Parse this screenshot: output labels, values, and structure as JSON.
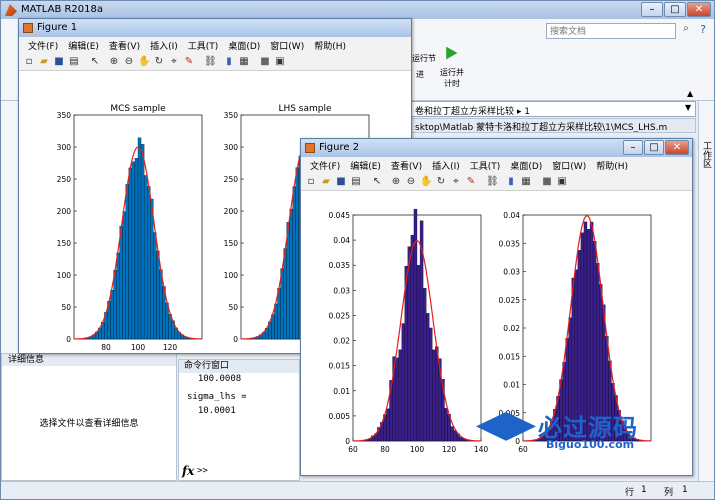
{
  "app": {
    "title": "MATLAB R2018a",
    "search_placeholder": "搜索文档",
    "toolstrip_run_section": "运行节",
    "toolstrip_advance": "进",
    "toolstrip_run_time": "运行并\n计时",
    "address_path": "卷和拉丁超立方采样比较 ▸ 1",
    "editor_tab": "sktop\\Matlab 蒙特卡洛和拉丁超立方采样比较\\1\\MCS_LHS.m",
    "right_panel_label": "工作区"
  },
  "detail_panel": {
    "title": "详细信息",
    "message": "选择文件以查看详细信息"
  },
  "command_window": {
    "title": "命令行窗口",
    "lines": [
      "  100.0008",
      "",
      "",
      "sigma_lhs =",
      "",
      "  10.0001"
    ],
    "prompt": ">>",
    "fx": "fx"
  },
  "status": {
    "line_label": "行",
    "line_value": "1",
    "col_label": "列",
    "col_value": "1"
  },
  "figure1": {
    "title": "Figure 1",
    "menu": [
      "文件(F)",
      "编辑(E)",
      "查看(V)",
      "插入(I)",
      "工具(T)",
      "桌面(D)",
      "窗口(W)",
      "帮助(H)"
    ]
  },
  "figure2": {
    "title": "Figure 2",
    "menu": [
      "文件(F)",
      "编辑(E)",
      "查看(V)",
      "插入(I)",
      "工具(T)",
      "桌面(D)",
      "窗口(W)",
      "帮助(H)"
    ]
  },
  "watermark": {
    "text1": "必过源码",
    "text2": "Biguo100.com"
  },
  "chart_data": [
    {
      "type": "bar",
      "title": "MCS sample",
      "ylim": [
        0,
        350
      ],
      "yticks": [
        0,
        50,
        100,
        150,
        200,
        250,
        300,
        350
      ],
      "xlim": [
        60,
        140
      ],
      "xticks": [
        80,
        100,
        120
      ],
      "mean": 100,
      "sigma": 10,
      "peak": 300,
      "bar_color": "#0072BD",
      "curve_color": "#e0231c"
    },
    {
      "type": "bar",
      "title": "LHS sample",
      "ylim": [
        0,
        350
      ],
      "yticks": [
        0,
        50,
        100,
        150,
        200,
        250,
        300,
        350
      ],
      "xlim": [
        60,
        140
      ],
      "xticks": [],
      "mean": 100,
      "sigma": 10,
      "peak": 300,
      "bar_color": "#0072BD",
      "curve_color": "#e0231c"
    },
    {
      "type": "bar",
      "title": "",
      "ylim": [
        0,
        0.045
      ],
      "yticks": [
        0,
        0.005,
        0.01,
        0.015,
        0.02,
        0.025,
        0.03,
        0.035,
        0.04,
        0.045
      ],
      "xlim": [
        60,
        140
      ],
      "xticks": [
        60,
        80,
        100,
        120,
        140
      ],
      "mean": 100,
      "sigma": 10,
      "peak": 0.0399,
      "bar_color": "#3a1f8c",
      "curve_color": "#e0231c"
    },
    {
      "type": "bar",
      "title": "",
      "ylim": [
        0,
        0.04
      ],
      "yticks": [
        0,
        0.005,
        0.01,
        0.015,
        0.02,
        0.025,
        0.03,
        0.035,
        0.04
      ],
      "xlim": [
        60,
        140
      ],
      "xticks": [
        60
      ],
      "mean": 100,
      "sigma": 10,
      "peak": 0.0399,
      "bar_color": "#3a1f8c",
      "curve_color": "#e0231c"
    }
  ]
}
